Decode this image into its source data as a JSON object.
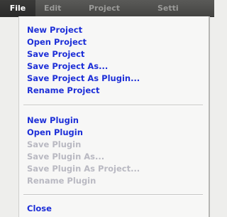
{
  "menubar": {
    "items": [
      {
        "label": "File"
      },
      {
        "label": "Edit"
      },
      {
        "label": "Project"
      },
      {
        "label": "Setti"
      }
    ]
  },
  "file_menu": {
    "group1": [
      {
        "label": "New Project",
        "enabled": true
      },
      {
        "label": "Open Project",
        "enabled": true
      },
      {
        "label": "Save Project",
        "enabled": true
      },
      {
        "label": "Save Project As...",
        "enabled": true
      },
      {
        "label": "Save Project As Plugin...",
        "enabled": true
      },
      {
        "label": "Rename Project",
        "enabled": true
      }
    ],
    "group2": [
      {
        "label": "New Plugin",
        "enabled": true
      },
      {
        "label": "Open Plugin",
        "enabled": true
      },
      {
        "label": "Save Plugin",
        "enabled": false
      },
      {
        "label": "Save Plugin As...",
        "enabled": false
      },
      {
        "label": "Save Plugin As Project...",
        "enabled": false
      },
      {
        "label": "Rename Plugin",
        "enabled": false
      }
    ],
    "group3": [
      {
        "label": "Close",
        "enabled": true
      }
    ]
  },
  "colors": {
    "enabled_text": "#1d2fd8",
    "disabled_text": "#b9b9c2",
    "menubar_bg": "#4f4f4d",
    "menubar_active_text": "#ffffff",
    "menubar_inactive_text": "#9a9a98"
  }
}
